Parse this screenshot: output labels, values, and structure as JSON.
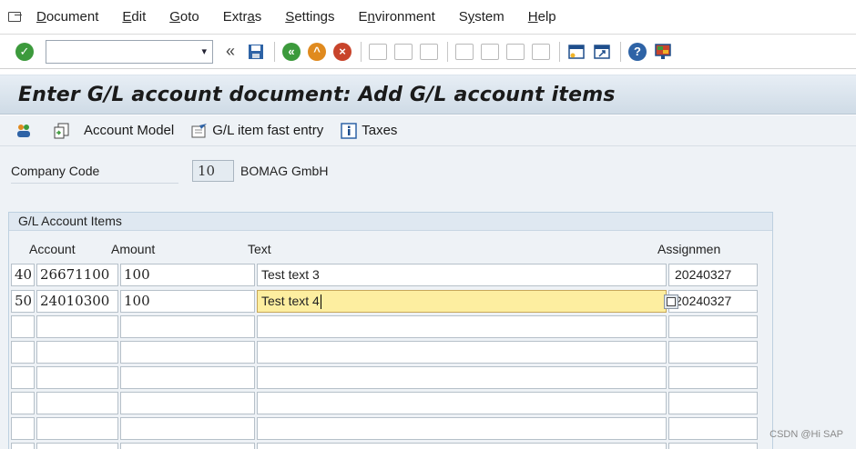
{
  "menu": {
    "items": [
      {
        "name": "document",
        "underline": "D",
        "rest": "ocument"
      },
      {
        "name": "edit",
        "underline": "E",
        "rest": "dit"
      },
      {
        "name": "goto",
        "underline": "G",
        "rest": "oto"
      },
      {
        "name": "extras",
        "pre": "Extr",
        "underline": "a",
        "rest": "s"
      },
      {
        "name": "settings",
        "underline": "S",
        "rest": "ettings"
      },
      {
        "name": "environment",
        "pre": "E",
        "underline": "n",
        "rest": "vironment"
      },
      {
        "name": "system",
        "pre": "S",
        "underline": "y",
        "rest": "stem"
      },
      {
        "name": "help",
        "underline": "H",
        "rest": "elp"
      }
    ]
  },
  "toolbar": {
    "command_field": "",
    "dropdown_glyph": "▾",
    "history_glyph": "«"
  },
  "title": "Enter G/L account document: Add G/L account items",
  "app_toolbar": {
    "account_model": "Account Model",
    "gl_fast_entry": "G/L item fast entry",
    "taxes": "Taxes"
  },
  "header": {
    "company_code_label": "Company Code",
    "company_code": "10",
    "company_name": "BOMAG GmbH"
  },
  "items": {
    "title": "G/L Account Items",
    "columns": {
      "account": "Account",
      "amount": "Amount",
      "text": "Text",
      "assignment": "Assignmen"
    },
    "rows": [
      {
        "pk": "40",
        "account": "26671100",
        "amount": "100",
        "text": "Test text 3",
        "assignment": "20240327"
      },
      {
        "pk": "50",
        "account": "24010300",
        "amount": "100",
        "text": "Test text 4",
        "assignment": "20240327"
      },
      {
        "pk": "",
        "account": "",
        "amount": "",
        "text": "",
        "assignment": ""
      },
      {
        "pk": "",
        "account": "",
        "amount": "",
        "text": "",
        "assignment": ""
      },
      {
        "pk": "",
        "account": "",
        "amount": "",
        "text": "",
        "assignment": ""
      },
      {
        "pk": "",
        "account": "",
        "amount": "",
        "text": "",
        "assignment": ""
      },
      {
        "pk": "",
        "account": "",
        "amount": "",
        "text": "",
        "assignment": ""
      },
      {
        "pk": "",
        "account": "",
        "amount": "",
        "text": "",
        "assignment": ""
      }
    ]
  },
  "watermark": "CSDN @Hi SAP",
  "colors": {
    "title_bar": "#cfdbe6",
    "focus_cell": "#fdeea0",
    "ok_green": "#3c9a3c",
    "cancel_red": "#c8442b"
  }
}
